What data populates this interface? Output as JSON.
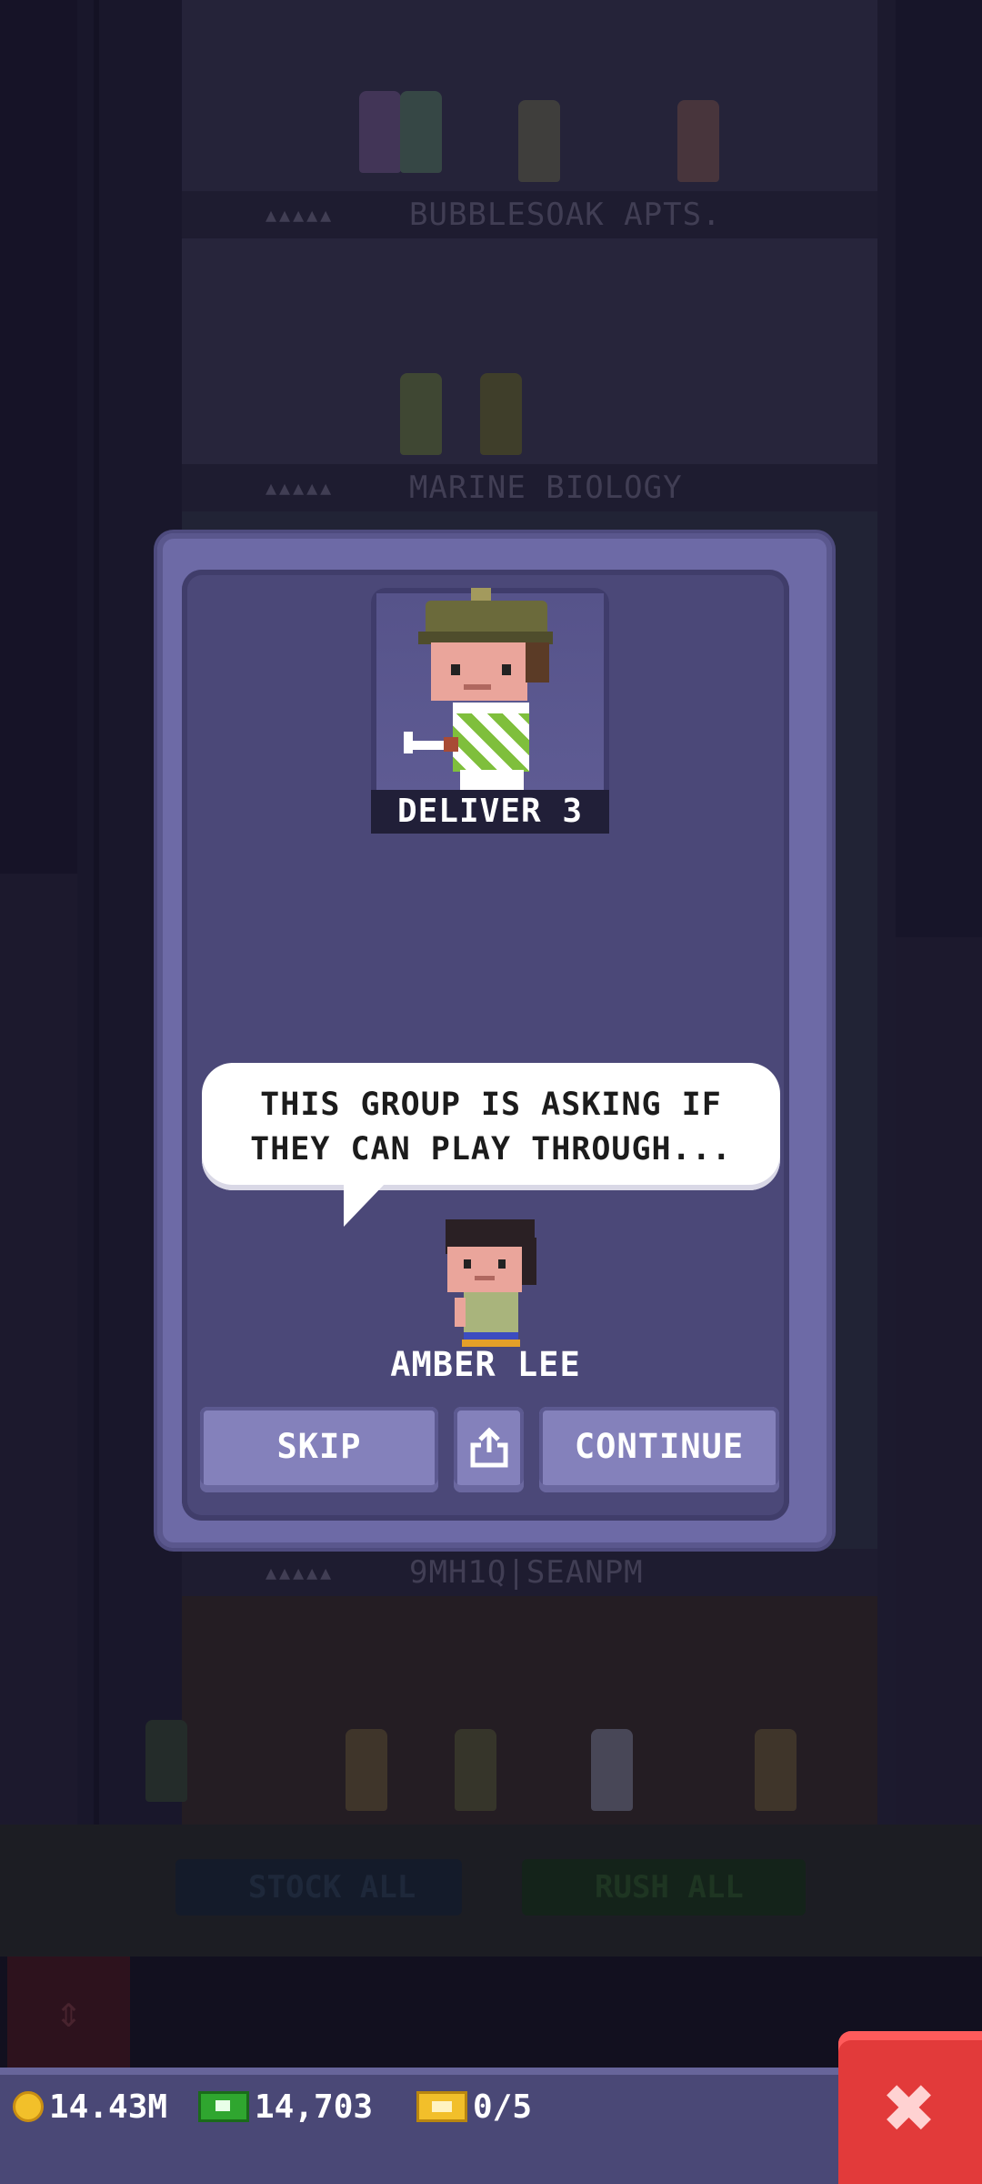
{
  "background": {
    "floors": [
      {
        "stars": "▲▲▲▲▲",
        "name": "BUBBLESOAK APTS."
      },
      {
        "stars": "▲▲▲▲▲",
        "name": "MARINE BIOLOGY"
      },
      {
        "stars": "▲▲▲▲▲",
        "name": "9MH1Q|SEANPM"
      }
    ],
    "stock_all_label": "STOCK ALL",
    "rush_all_label": "RUSH ALL"
  },
  "dialog": {
    "portrait_caption": "DELIVER 3",
    "speech_lines": [
      "THIS GROUP IS ASKING IF",
      "THEY CAN PLAY THROUGH..."
    ],
    "speaker_name": "AMBER LEE",
    "skip_label": "SKIP",
    "share_icon": "share-icon",
    "continue_label": "CONTINUE"
  },
  "status_bar": {
    "coins": "14.43M",
    "bux": "14,703",
    "tickets": "0/5"
  },
  "colors": {
    "modal_frame": "#6d6aa6",
    "modal_panel": "#4b4878",
    "button": "#8481bb",
    "close_button": "#e23a3a",
    "status_bar": "#4a4876"
  }
}
